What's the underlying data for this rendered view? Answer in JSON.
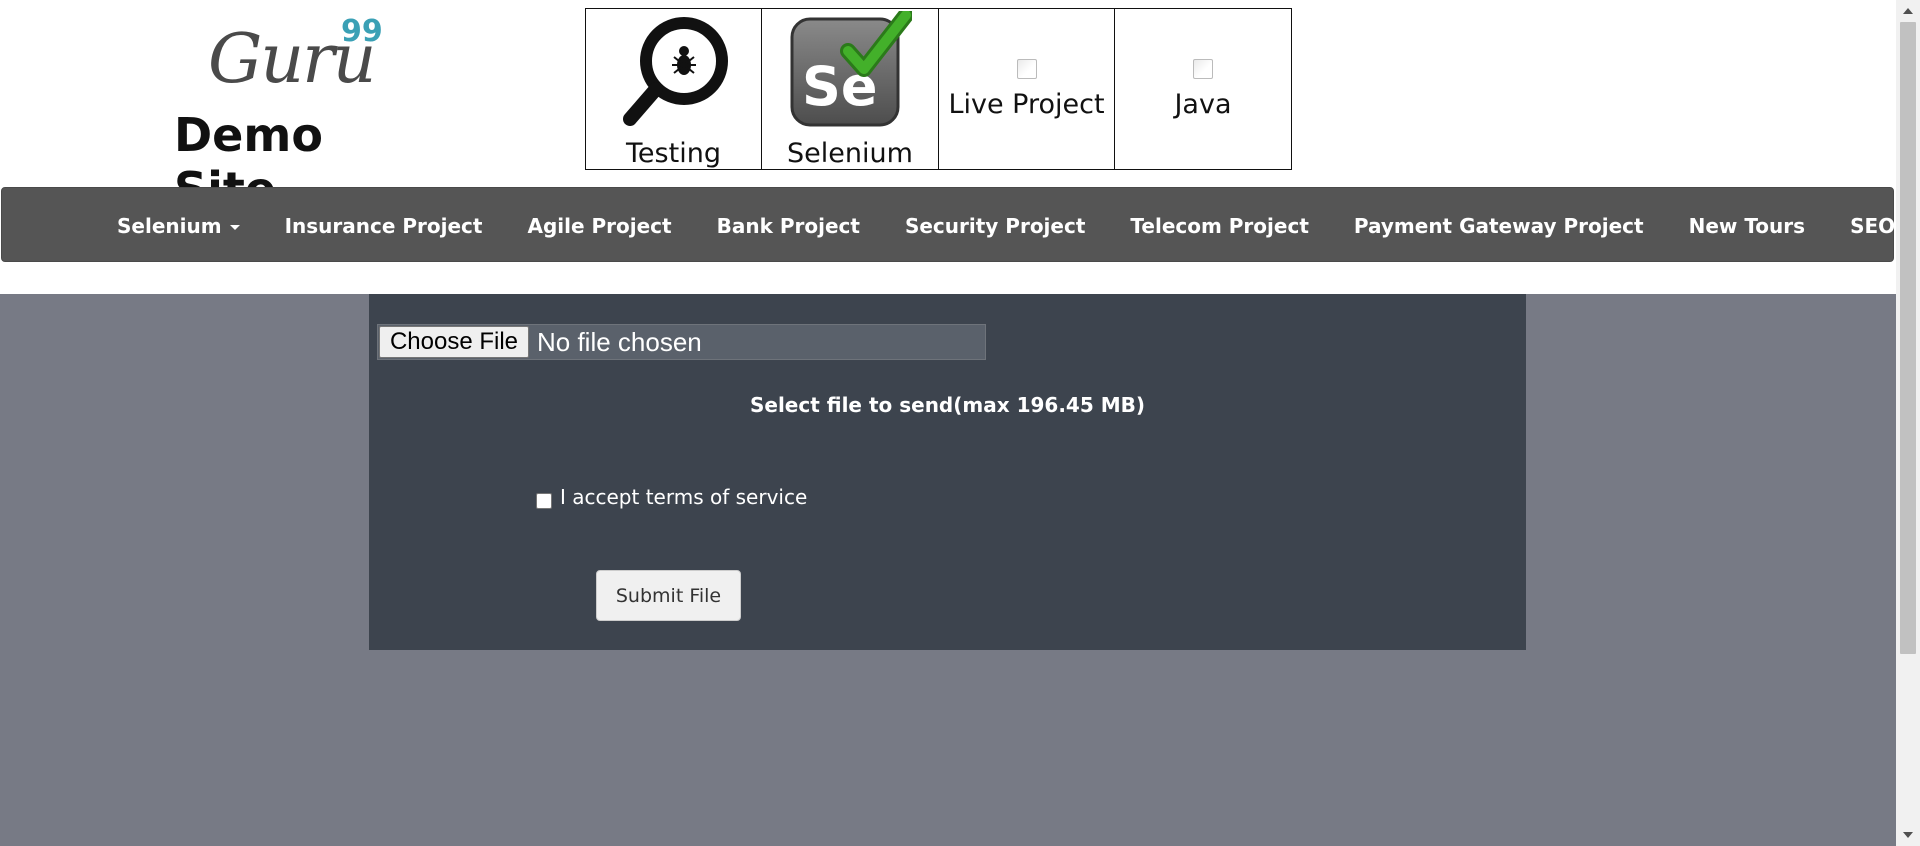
{
  "logo": {
    "brand": "Guru",
    "superscript": "99",
    "subtitle": "Demo Site"
  },
  "tiles": [
    {
      "label": "Testing",
      "icon": "magnifier-bug-icon"
    },
    {
      "label": "Selenium",
      "icon": "selenium-logo-icon"
    },
    {
      "label": "Live Project",
      "icon": "broken-image-icon"
    },
    {
      "label": "Java",
      "icon": "broken-image-icon"
    }
  ],
  "nav": {
    "items": [
      {
        "label": "Selenium",
        "dropdown": true
      },
      {
        "label": "Insurance Project"
      },
      {
        "label": "Agile Project"
      },
      {
        "label": "Bank Project"
      },
      {
        "label": "Security Project"
      },
      {
        "label": "Telecom Project"
      },
      {
        "label": "Payment Gateway Project"
      },
      {
        "label": "New Tours"
      },
      {
        "label": "SEO",
        "dropdown": true
      }
    ]
  },
  "upload": {
    "choose_button": "Choose File",
    "file_status": "No file chosen",
    "instruction": "Select file to send(max 196.45 MB)",
    "terms_label": "I accept terms of service",
    "terms_checked": false,
    "submit_label": "Submit File"
  },
  "colors": {
    "nav_bg": "#555555",
    "panel_bg": "#3d444e",
    "page_bg": "#777a85",
    "logo_accent": "#3aa0b5",
    "selenium_green": "#43b02a"
  }
}
